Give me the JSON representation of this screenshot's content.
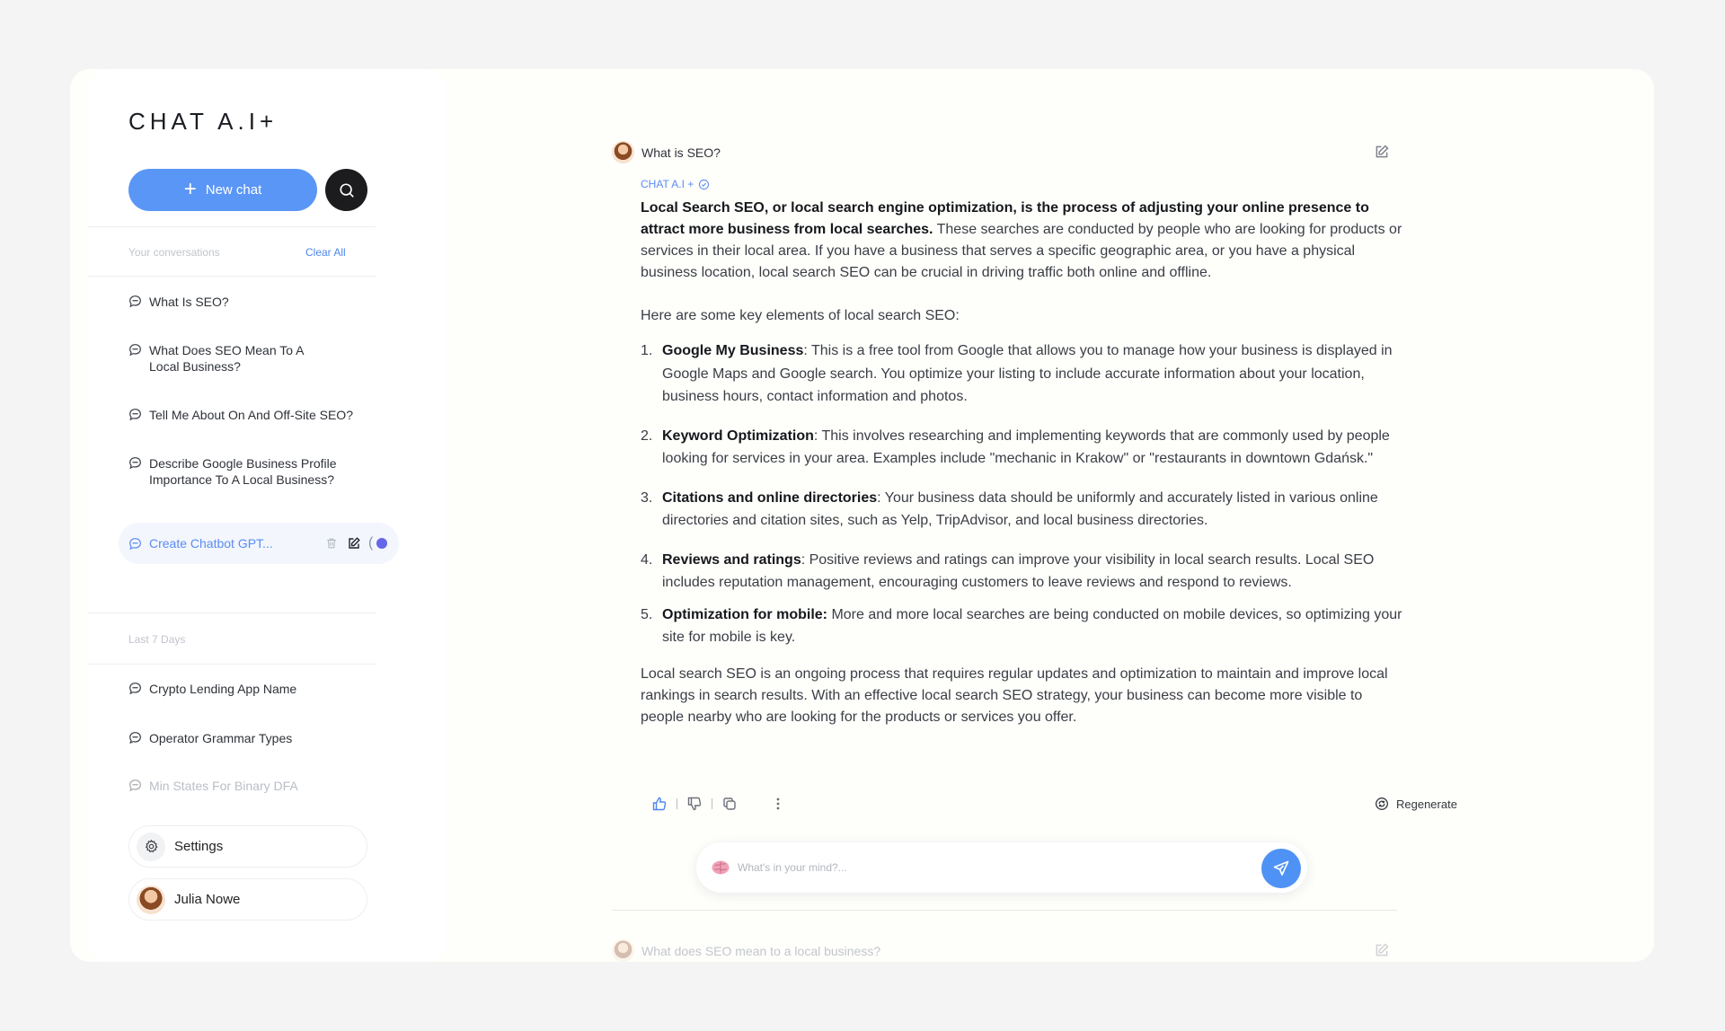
{
  "app": {
    "logo": "CHAT A.I+"
  },
  "sidebar": {
    "new_chat_label": "New chat",
    "conversations_label": "Your conversations",
    "clear_all_label": "Clear All",
    "conversations": [
      {
        "title": "What Is SEO?"
      },
      {
        "title": "What Does SEO Mean To A Local Business?"
      },
      {
        "title": "Tell Me About On And Off-Site SEO?"
      },
      {
        "title": "Describe Google Business Profile Importance To A Local Business?"
      }
    ],
    "active_conversation": {
      "title": "Create Chatbot GPT...",
      "paren": "("
    },
    "last7_label": "Last 7 Days",
    "last7": [
      {
        "title": "Crypto Lending App Name"
      },
      {
        "title": "Operator Grammar Types"
      },
      {
        "title": "Min States For Binary DFA"
      }
    ],
    "settings_label": "Settings",
    "user_name": "Julia Nowe"
  },
  "chat": {
    "question": "What is SEO?",
    "bot_name": "CHAT A.I +",
    "intro_bold": "Local Search SEO, or local search engine optimization, is the process of adjusting your online presence to attract more business from local searches.",
    "intro_rest": " These searches are conducted by people who are looking for products or services in their local area. If you have a business that serves a specific geographic area, or you have a physical business location, local search SEO can be crucial in driving traffic both online and offline.",
    "list_intro": "Here are some key elements of local search SEO:",
    "items": [
      {
        "num": "1.",
        "title": "Google My Business",
        "text": ": This is a free tool from Google that allows you to manage how your business is displayed in Google Maps and Google search. You optimize your listing to include accurate information about your location, business hours, contact information and photos."
      },
      {
        "num": "2.",
        "title": "Keyword Optimization",
        "text": ": This involves researching and implementing keywords that are commonly used by people looking for services in your area. Examples include \"mechanic in Krakow\" or \"restaurants in downtown Gdańsk.\""
      },
      {
        "num": "3.",
        "title": "Citations and online directories",
        "text": ": Your business data should be uniformly and accurately listed in various online directories and citation sites, such as Yelp, TripAdvisor, and local business directories."
      },
      {
        "num": "4.",
        "title": "Reviews and ratings",
        "text": ": Positive reviews and ratings can improve your visibility in local search results. Local SEO includes reputation management, encouraging customers to leave reviews and respond to reviews."
      },
      {
        "num": "5.",
        "title": "Optimization for mobile:",
        "text": " More and more local searches are being conducted on mobile devices, so optimizing your site for mobile is key."
      }
    ],
    "conclusion": "Local search SEO is an ongoing process that requires regular updates and optimization to maintain and improve local rankings in search results. With an effective local search SEO strategy, your business can become more visible to people nearby who are looking for the products or services you offer.",
    "regenerate_label": "Regenerate",
    "input_placeholder": "What's in your mind?...",
    "next_question": "What does SEO mean to a local business?"
  },
  "colors": {
    "accent": "#5a96f6",
    "active_dot": "#6566e8",
    "send": "#4f92f5"
  },
  "icons": [
    "search-icon",
    "plus-icon",
    "chat-bubble-icon",
    "trash-icon",
    "edit-icon",
    "gear-icon",
    "verified-icon",
    "thumbs-up-icon",
    "thumbs-down-icon",
    "copy-icon",
    "more-vertical-icon",
    "regenerate-icon",
    "brain-icon",
    "send-icon"
  ]
}
